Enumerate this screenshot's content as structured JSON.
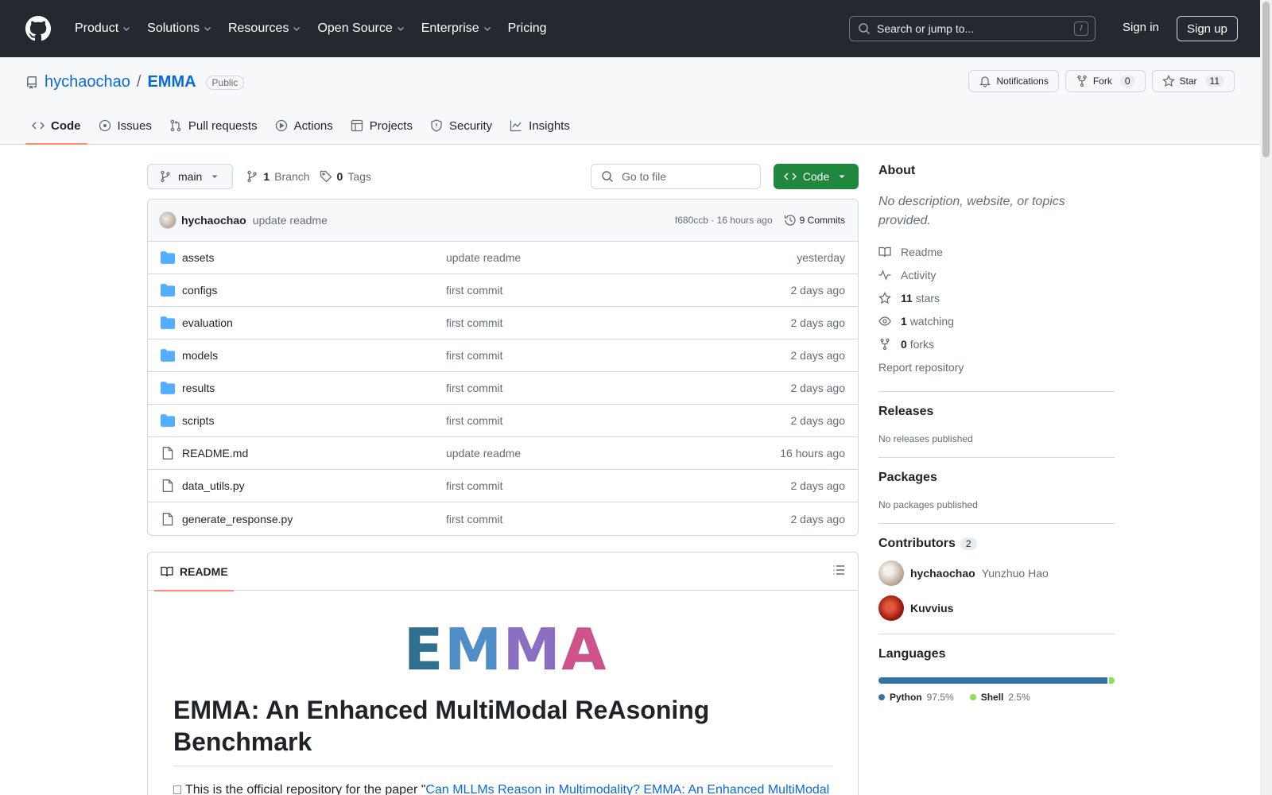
{
  "header": {
    "nav": [
      "Product",
      "Solutions",
      "Resources",
      "Open Source",
      "Enterprise",
      "Pricing"
    ],
    "search_placeholder": "Search or jump to...",
    "search_shortcut": "/",
    "signin": "Sign in",
    "signup": "Sign up"
  },
  "repo": {
    "owner": "hychaochao",
    "separator": "/",
    "name": "EMMA",
    "visibility": "Public",
    "notifications_label": "Notifications",
    "fork_label": "Fork",
    "fork_count": "0",
    "star_label": "Star",
    "star_count": "11",
    "tabs": [
      "Code",
      "Issues",
      "Pull requests",
      "Actions",
      "Projects",
      "Security",
      "Insights"
    ]
  },
  "toolbar": {
    "branch": "main",
    "branch_count": "1",
    "branch_label": "Branch",
    "tag_count": "0",
    "tag_label": "Tags",
    "go_to_file": "Go to file",
    "code_label": "Code"
  },
  "latest_commit": {
    "author": "hychaochao",
    "message": "update readme",
    "hash_time": "f680ccb · 16 hours ago",
    "commits": "9 Commits"
  },
  "files": [
    {
      "name": "assets",
      "type": "dir",
      "message": "update readme",
      "date": "yesterday"
    },
    {
      "name": "configs",
      "type": "dir",
      "message": "first commit",
      "date": "2 days ago"
    },
    {
      "name": "evaluation",
      "type": "dir",
      "message": "first commit",
      "date": "2 days ago"
    },
    {
      "name": "models",
      "type": "dir",
      "message": "first commit",
      "date": "2 days ago"
    },
    {
      "name": "results",
      "type": "dir",
      "message": "first commit",
      "date": "2 days ago"
    },
    {
      "name": "scripts",
      "type": "dir",
      "message": "first commit",
      "date": "2 days ago"
    },
    {
      "name": "README.md",
      "type": "file",
      "message": "update readme",
      "date": "16 hours ago"
    },
    {
      "name": "data_utils.py",
      "type": "file",
      "message": "first commit",
      "date": "2 days ago"
    },
    {
      "name": "generate_response.py",
      "type": "file",
      "message": "first commit",
      "date": "2 days ago"
    }
  ],
  "readme": {
    "tab": "README",
    "logo_text": "EMMA",
    "title": "EMMA: An Enhanced MultiModal ReAsoning Benchmark",
    "intro_prefix": "This is the official repository for the paper \"",
    "intro_link": "Can MLLMs Reason in Multimodality? EMMA: An Enhanced MultiModal"
  },
  "about": {
    "heading": "About",
    "description": "No description, website, or topics provided.",
    "readme": "Readme",
    "activity": "Activity",
    "stars_count": "11",
    "stars_label": "stars",
    "watching_count": "1",
    "watching_label": "watching",
    "forks_count": "0",
    "forks_label": "forks",
    "report": "Report repository"
  },
  "releases": {
    "heading": "Releases",
    "text": "No releases published"
  },
  "packages": {
    "heading": "Packages",
    "text": "No packages published"
  },
  "contributors": {
    "heading": "Contributors",
    "count": "2",
    "list": [
      {
        "login": "hychaochao",
        "name": "Yunzhuo Hao"
      },
      {
        "login": "Kuvvius",
        "name": ""
      }
    ]
  },
  "languages": {
    "heading": "Languages",
    "items": [
      {
        "name": "Python",
        "pct": "97.5%",
        "value": 97.5,
        "color": "#3572A5"
      },
      {
        "name": "Shell",
        "pct": "2.5%",
        "value": 2.5,
        "color": "#89e051"
      }
    ]
  },
  "colors": {
    "accent": "#0969da",
    "green": "#1f883d",
    "tab_underline": "#fd8c73"
  }
}
